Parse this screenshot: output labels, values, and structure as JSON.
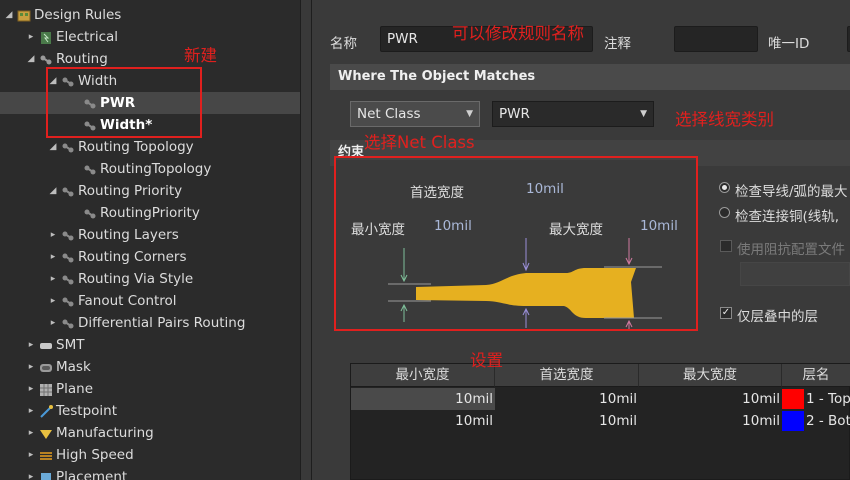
{
  "tree": [
    {
      "label": "Design Rules",
      "arrow": "◢",
      "icon": "design-rules-icon",
      "bold": false,
      "selected": false
    },
    {
      "label": "Electrical",
      "arrow": "▸",
      "icon": "electrical-icon",
      "bold": false,
      "selected": false
    },
    {
      "label": "Routing",
      "arrow": "◢",
      "icon": "routing-icon",
      "bold": false,
      "selected": false
    },
    {
      "label": "Width",
      "arrow": "◢",
      "icon": "rule-icon",
      "bold": false,
      "selected": false
    },
    {
      "label": "PWR",
      "arrow": "",
      "icon": "rule-icon",
      "bold": true,
      "selected": true
    },
    {
      "label": "Width*",
      "arrow": "",
      "icon": "rule-icon",
      "bold": true,
      "selected": false
    },
    {
      "label": "Routing Topology",
      "arrow": "◢",
      "icon": "rule-icon",
      "bold": false,
      "selected": false
    },
    {
      "label": "RoutingTopology",
      "arrow": "",
      "icon": "rule-icon",
      "bold": false,
      "selected": false
    },
    {
      "label": "Routing Priority",
      "arrow": "◢",
      "icon": "rule-icon",
      "bold": false,
      "selected": false
    },
    {
      "label": "RoutingPriority",
      "arrow": "",
      "icon": "rule-icon",
      "bold": false,
      "selected": false
    },
    {
      "label": "Routing Layers",
      "arrow": "▸",
      "icon": "rule-icon",
      "bold": false,
      "selected": false
    },
    {
      "label": "Routing Corners",
      "arrow": "▸",
      "icon": "rule-icon",
      "bold": false,
      "selected": false
    },
    {
      "label": "Routing Via Style",
      "arrow": "▸",
      "icon": "rule-icon",
      "bold": false,
      "selected": false
    },
    {
      "label": "Fanout Control",
      "arrow": "▸",
      "icon": "rule-icon",
      "bold": false,
      "selected": false
    },
    {
      "label": "Differential Pairs Routing",
      "arrow": "▸",
      "icon": "rule-icon",
      "bold": false,
      "selected": false
    },
    {
      "label": "SMT",
      "arrow": "▸",
      "icon": "smt-icon",
      "bold": false,
      "selected": false
    },
    {
      "label": "Mask",
      "arrow": "▸",
      "icon": "mask-icon",
      "bold": false,
      "selected": false
    },
    {
      "label": "Plane",
      "arrow": "▸",
      "icon": "plane-icon",
      "bold": false,
      "selected": false
    },
    {
      "label": "Testpoint",
      "arrow": "▸",
      "icon": "testpoint-icon",
      "bold": false,
      "selected": false
    },
    {
      "label": "Manufacturing",
      "arrow": "▸",
      "icon": "manufacturing-icon",
      "bold": false,
      "selected": false
    },
    {
      "label": "High Speed",
      "arrow": "▸",
      "icon": "high-speed-icon",
      "bold": false,
      "selected": false
    },
    {
      "label": "Placement",
      "arrow": "▸",
      "icon": "placement-icon",
      "bold": false,
      "selected": false
    }
  ],
  "header": {
    "name_label": "名称",
    "name_value": "PWR",
    "comment_label": "注释",
    "comment_value": "",
    "uid_label": "唯一ID"
  },
  "where": {
    "title": "Where The Object Matches",
    "scope_type": "Net Class",
    "scope_value": "PWR"
  },
  "constraints": {
    "title": "约束",
    "preferred_label": "首选宽度",
    "preferred_value": "10mil",
    "min_label": "最小宽度",
    "min_value": "10mil",
    "max_label": "最大宽度",
    "max_value": "10mil",
    "radio1": "检查导线/弧的最大",
    "radio2": "检查连接铜(线轨,",
    "impedance_label": "使用阻抗配置文件",
    "layers_label": "仅层叠中的层"
  },
  "table": {
    "headers": [
      "最小宽度",
      "首选宽度",
      "最大宽度",
      "层名"
    ],
    "rows": [
      {
        "min": "10mil",
        "pref": "10mil",
        "max": "10mil",
        "layer": "1 - Top",
        "color": "#ff0000"
      },
      {
        "min": "10mil",
        "pref": "10mil",
        "max": "10mil",
        "layer": "2 - Bot",
        "color": "#0000ff"
      }
    ]
  },
  "annotations": {
    "new": "新建",
    "rename": "可以修改规则名称",
    "select_netclass": "选择Net Class",
    "select_width_class": "选择线宽类别",
    "set": "设置"
  },
  "colors": {
    "annotation": "#e0201e",
    "trace": "#e6b020",
    "value_blue": "#aab8d8"
  }
}
